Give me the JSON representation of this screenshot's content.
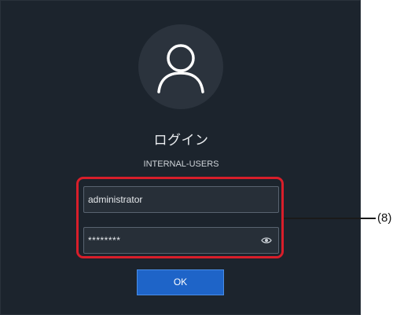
{
  "login": {
    "avatar_icon": "user-icon",
    "title": "ログイン",
    "subtitle": "INTERNAL-USERS",
    "username_value": "administrator",
    "password_value": "********",
    "password_toggle_icon": "eye-icon",
    "ok_label": "OK"
  },
  "annotation": {
    "label": "(8)",
    "highlight_color": "#d81e2a"
  },
  "colors": {
    "background": "#1c242d",
    "button": "#1e64c8"
  }
}
